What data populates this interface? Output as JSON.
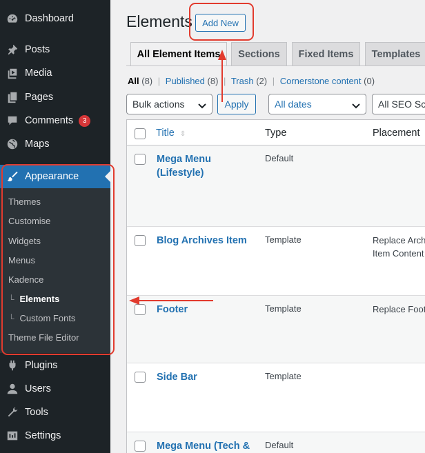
{
  "sidebar": {
    "items_top": [
      {
        "label": "Dashboard",
        "icon": "dashboard-icon"
      },
      {
        "label": "Posts",
        "icon": "pin-icon"
      },
      {
        "label": "Media",
        "icon": "media-icon"
      },
      {
        "label": "Pages",
        "icon": "pages-icon"
      },
      {
        "label": "Comments",
        "icon": "comment-icon",
        "badge": "3"
      },
      {
        "label": "Maps",
        "icon": "globe-icon"
      }
    ],
    "appearance": {
      "label": "Appearance",
      "icon": "brush-icon",
      "submenu": [
        "Themes",
        "Customise",
        "Widgets",
        "Menus",
        "Kadence",
        "Elements",
        "Custom Fonts",
        "Theme File Editor"
      ],
      "current": "Elements"
    },
    "items_bottom": [
      {
        "label": "Plugins",
        "icon": "plug-icon"
      },
      {
        "label": "Users",
        "icon": "user-icon"
      },
      {
        "label": "Tools",
        "icon": "wrench-icon"
      },
      {
        "label": "Settings",
        "icon": "settings-icon"
      }
    ]
  },
  "header": {
    "title": "Elements",
    "add_new_label": "Add New"
  },
  "tabs": [
    "All Element Items",
    "Sections",
    "Fixed Items",
    "Templates"
  ],
  "active_tab": "All Element Items",
  "filters": {
    "all_label": "All",
    "all_count": "(8)",
    "published_label": "Published",
    "published_count": "(8)",
    "trash_label": "Trash",
    "trash_count": "(2)",
    "cornerstone_label": "Cornerstone content",
    "cornerstone_count": "(0)",
    "separator": "|"
  },
  "actions": {
    "bulk_actions": "Bulk actions",
    "apply_label": "Apply",
    "dates": "All dates",
    "seo": "All SEO Sc"
  },
  "table": {
    "columns": [
      "Title",
      "Type",
      "Placement"
    ],
    "rows": [
      {
        "title": "Mega Menu (Lifestyle)",
        "type": "Default",
        "placement": ""
      },
      {
        "title": "Blog Archives Item",
        "type": "Template",
        "placement": "Replace Arch\nItem Content"
      },
      {
        "title": "Footer",
        "type": "Template",
        "placement": "Replace Foot"
      },
      {
        "title": "Side Bar",
        "type": "Template",
        "placement": ""
      },
      {
        "title": "Mega Menu (Tech &",
        "type": "Default",
        "placement": ""
      }
    ]
  },
  "colors": {
    "sidebar_bg": "#1d2327",
    "active_menu": "#2271b1",
    "link": "#2271b1",
    "annotation": "#e23b2e",
    "badge": "#d63638"
  }
}
